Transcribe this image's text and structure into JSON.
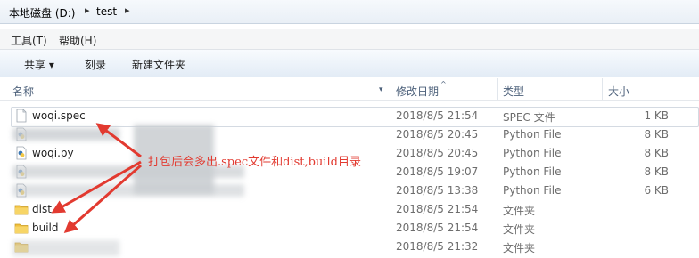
{
  "address": {
    "crumbs": [
      "本地磁盘 (D:)",
      "test"
    ],
    "separator": "▸"
  },
  "menu": [
    {
      "label": "工具(T)"
    },
    {
      "label": "帮助(H)"
    }
  ],
  "toolbar": {
    "share_label": "共享 ▾",
    "burn_label": "刻录",
    "new_folder_label": "新建文件夹"
  },
  "columns": {
    "name": "名称",
    "date": "修改日期",
    "type": "类型",
    "size": "大小"
  },
  "files": [
    {
      "name": "woqi.spec",
      "date": "2018/8/5 21:54",
      "type": "SPEC 文件",
      "size": "1 KB",
      "icon": "document-icon"
    },
    {
      "name": "",
      "date": "2018/8/5 20:45",
      "type": "Python File",
      "size": "8 KB",
      "icon": "python-file-icon"
    },
    {
      "name": "woqi.py",
      "date": "2018/8/5 20:45",
      "type": "Python File",
      "size": "8 KB",
      "icon": "python-file-icon"
    },
    {
      "name": "",
      "date": "2018/8/5 19:07",
      "type": "Python File",
      "size": "8 KB",
      "icon": "python-file-icon"
    },
    {
      "name": "",
      "date": "2018/8/5 13:38",
      "type": "Python File",
      "size": "6 KB",
      "icon": "python-file-icon"
    },
    {
      "name": "dist",
      "date": "2018/8/5 21:54",
      "type": "文件夹",
      "size": "",
      "icon": "folder-icon"
    },
    {
      "name": "build",
      "date": "2018/8/5 21:54",
      "type": "文件夹",
      "size": "",
      "icon": "folder-icon"
    },
    {
      "name": "",
      "date": "2018/8/5 21:32",
      "type": "文件夹",
      "size": "",
      "icon": "folder-icon"
    }
  ],
  "annotation": {
    "text": "打包后会多出.spec文件和dist,build目录",
    "color": "#e23a30"
  },
  "colors": {
    "header_text": "#4c607a",
    "folder": "#f0c040"
  }
}
